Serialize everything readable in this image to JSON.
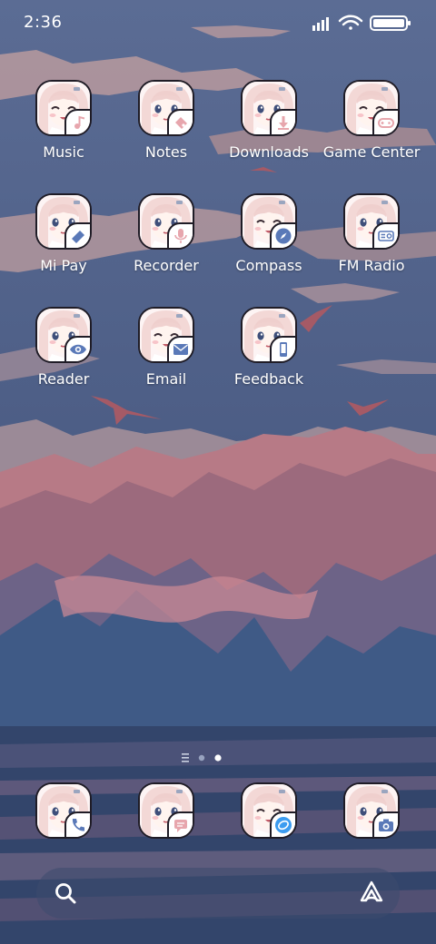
{
  "status_bar": {
    "time": "2:36",
    "icons": [
      "signal-icon",
      "wifi-icon",
      "battery-icon"
    ]
  },
  "apps": [
    {
      "label": "Music",
      "badge_icon": "music-icon",
      "accent": "#e7a6ad"
    },
    {
      "label": "Notes",
      "badge_icon": "notes-icon",
      "accent": "#e7a6ad"
    },
    {
      "label": "Downloads",
      "badge_icon": "download-icon",
      "accent": "#e7a6ad"
    },
    {
      "label": "Game Center",
      "badge_icon": "gamepad-icon",
      "accent": "#e7a6ad"
    },
    {
      "label": "Mi Pay",
      "badge_icon": "card-icon",
      "accent": "#5a79b8"
    },
    {
      "label": "Recorder",
      "badge_icon": "microphone-icon",
      "accent": "#e7a6ad"
    },
    {
      "label": "Compass",
      "badge_icon": "compass-icon",
      "accent": "#5a79b8"
    },
    {
      "label": "FM Radio",
      "badge_icon": "radio-icon",
      "accent": "#5a79b8"
    },
    {
      "label": "Reader",
      "badge_icon": "eye-icon",
      "accent": "#5a79b8"
    },
    {
      "label": "Email",
      "badge_icon": "envelope-icon",
      "accent": "#5a79b8"
    },
    {
      "label": "Feedback",
      "badge_icon": "phone-feedback-icon",
      "accent": "#5a79b8"
    }
  ],
  "page_indicator": {
    "pages": 2,
    "current": 2
  },
  "dock": [
    {
      "badge_icon": "phone-icon",
      "accent": "#5a79b8"
    },
    {
      "badge_icon": "message-icon",
      "accent": "#e7a6ad"
    },
    {
      "badge_icon": "browser-icon",
      "accent": "#3c9cf0"
    },
    {
      "badge_icon": "camera-icon",
      "accent": "#5a79b8"
    }
  ],
  "search_bar": {
    "left_icon": "search-icon",
    "right_icon": "assistant-icon"
  }
}
